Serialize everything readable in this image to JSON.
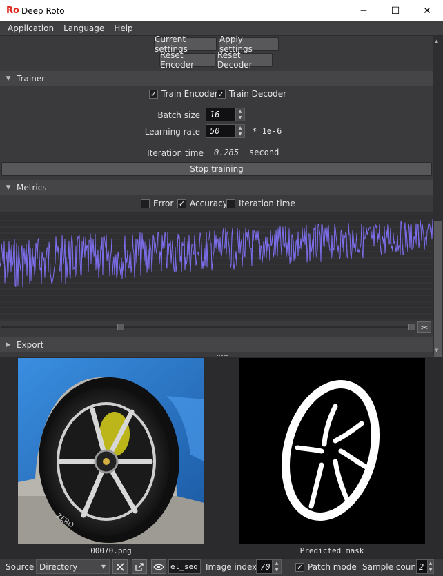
{
  "window": {
    "logo": "Ro",
    "title": "Deep Roto",
    "minimize": "─",
    "maximize": "☐",
    "close": "✕"
  },
  "menu": [
    "Application",
    "Language",
    "Help"
  ],
  "settings": {
    "current_settings": "Current settings",
    "apply_settings": "Apply settings",
    "reset_encoder": "Reset Encoder",
    "reset_decoder": "Reset Decoder"
  },
  "trainer": {
    "title": "Trainer",
    "train_encoder": "Train Encoder",
    "train_decoder": "Train Decoder",
    "train_encoder_checked": true,
    "train_decoder_checked": true,
    "batch_size_label": "Batch size",
    "batch_size": "16",
    "learning_rate_label": "Learning rate",
    "learning_rate": "50",
    "learning_rate_unit": "* 1e-6",
    "iteration_time_label": "Iteration time",
    "iteration_time": "0.285",
    "iteration_time_unit": "second",
    "stop_training": "Stop training"
  },
  "metrics": {
    "title": "Metrics",
    "error": "Error",
    "accuracy": "Accuracy",
    "iteration_time": "Iteration time",
    "error_checked": false,
    "accuracy_checked": true,
    "iteration_time_checked": false,
    "series_color": "#7e6ff0"
  },
  "export": {
    "title": "Export"
  },
  "images": {
    "source_caption": "00070.png",
    "mask_caption": "Predicted mask"
  },
  "bottom": {
    "source_label": "Source",
    "source_value": "Directory",
    "path_value": "el_seq",
    "image_index_label": "Image index",
    "image_index": "70",
    "patch_mode": "Patch mode",
    "patch_mode_checked": true,
    "sample_count_label": "Sample count",
    "sample_count": "2"
  },
  "colors": {
    "accent_logo": "#e1281e",
    "car_blue": "#2f7fd1",
    "brake_yellow": "#d9d21c"
  }
}
